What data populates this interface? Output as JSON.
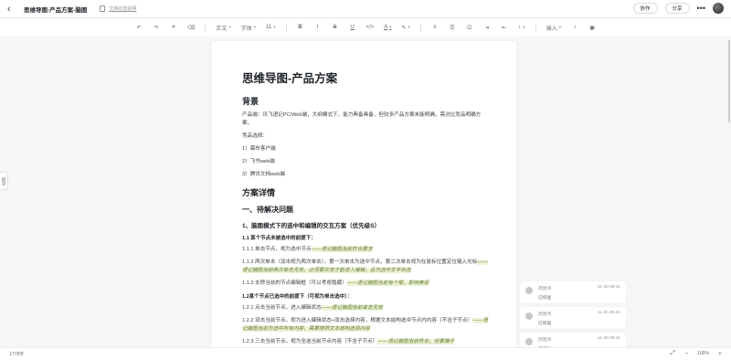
{
  "header": {
    "title": "思维导图-产品方案-脑图",
    "subtitle": "文档状态说明",
    "collab_label": "协作",
    "share_label": "分享",
    "more_label": "•••"
  },
  "toolbar": {
    "undo": "↶",
    "redo": "↷",
    "format_brush": "⌗",
    "clear_format": "⌫",
    "paragraph_style": "正文",
    "font_family": "字体",
    "font_size": "11",
    "bold": "B",
    "italic": "I",
    "strike": "S",
    "underline": "U",
    "code": "</>",
    "font_color": "A",
    "highlight": "✎",
    "align": "≡",
    "list": "☰",
    "checkbox": "☑",
    "indent": "⇥",
    "outdent": "⇤",
    "line_spacing": "↕",
    "insert": "插入",
    "voice": "♪",
    "media": "▣"
  },
  "sidebar": {
    "tab_label": "目录"
  },
  "document": {
    "title": "思维导图-产品方案",
    "blocks": [
      {
        "type": "h1",
        "text": "背景"
      },
      {
        "type": "p",
        "text": "产品端：讯飞语记PC/Web端，大纲模式下，能力典备具备，但较多产品方案未能明确，需对比竞品明确方案。"
      },
      {
        "type": "p",
        "text": "竞品选择："
      },
      {
        "type": "p",
        "text": "1）幕布客户端"
      },
      {
        "type": "p",
        "text": "2）飞书web端"
      },
      {
        "type": "p",
        "text": "3）腾讯文档web端"
      },
      {
        "type": "h1",
        "text": "方案详情"
      },
      {
        "type": "h2",
        "text": "一、待解决问题"
      },
      {
        "type": "h3",
        "text": "1、脑图模式下的选中和编辑的交互方案（优先级S）"
      },
      {
        "type": "h4",
        "text": "1.1 某个节点未被选中的前提下："
      },
      {
        "type": "p",
        "text": "1.1.1 单击节点，视为选中节点",
        "hl": "——语记脑图当前符合要求"
      },
      {
        "type": "p",
        "text": "1.1.2 两次单击（双击视为两次单击），第一次单击为选中节点，第二次单击视为在鼠标位置定位输入光标",
        "hl": "——语记脑图当前两次单击无效，必须要双击才能进入编辑，且为选中文字状态"
      },
      {
        "type": "p",
        "text": "1.1.3 去除当前的节点编辑框（可以考虑隐藏）",
        "hl": "——语记脑图当前有个框，影响美观"
      },
      {
        "type": "h4",
        "text": "1.2某个节点已选中的前提下（可视为单击选中）："
      },
      {
        "type": "p",
        "text": "1.2.1 点击当前节点，进入编辑状态",
        "hl": "——语记脑图当前单击无效"
      },
      {
        "type": "p",
        "text": "1.2.2 双击当前节点，视为进入编辑状态+双击选择内容，根据文本结构选中节点内内容（不含子节点）",
        "hl": "——语记脑图当前为选中所有内容，需要按照文本结构选择内容"
      },
      {
        "type": "p",
        "text": "1.2.3 三击当前节点，视为全选当前节点内容（不含子节点）",
        "hl": "——语记脑图当前符合，但要确不"
      }
    ]
  },
  "comments": [
    {
      "name": "周建伟",
      "time": "11-30 09:41",
      "status": "已恢复"
    },
    {
      "name": "周建伟",
      "time": "11-30 09:41",
      "status": "已恢复"
    },
    {
      "name": "周建伟",
      "time": "11-30 09:41",
      "status": "已恢复"
    }
  ],
  "statusbar": {
    "word_count": "1778字",
    "zoom": "100%",
    "zoom_out": "−",
    "zoom_in": "+",
    "fit": "⤢",
    "fullscreen": "⛶"
  }
}
